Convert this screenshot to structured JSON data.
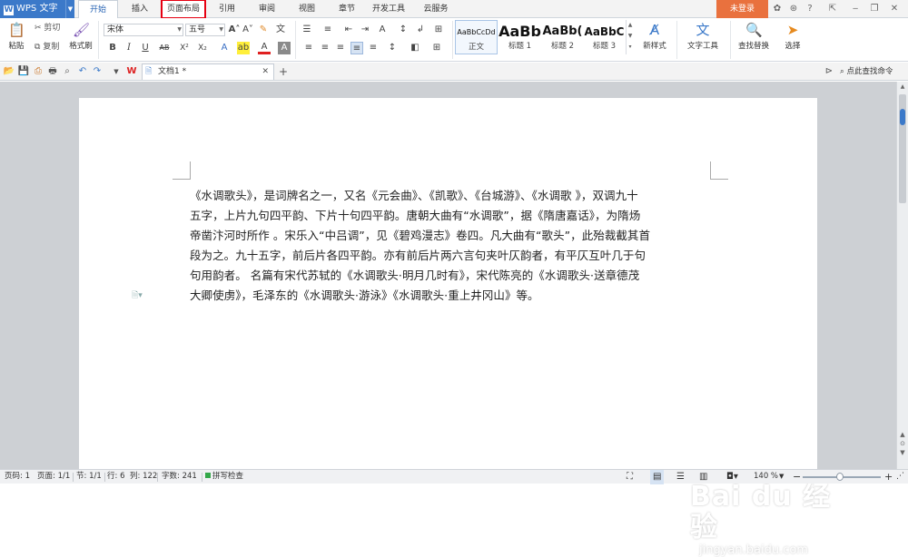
{
  "app": {
    "name": "WPS 文字",
    "login_label": "未登录"
  },
  "tabs": [
    "开始",
    "插入",
    "页面布局",
    "引用",
    "审阅",
    "视图",
    "章节",
    "开发工具",
    "云服务"
  ],
  "ribbon": {
    "clipboard": {
      "paste": "粘贴",
      "cut": "剪切",
      "copy": "复制",
      "format_painter": "格式刷"
    },
    "font": {
      "name": "宋体",
      "size": "五号"
    },
    "styles": [
      {
        "preview": "AaBbCcDd",
        "label": "正文"
      },
      {
        "preview": "AaBb",
        "label": "标题 1"
      },
      {
        "preview": "AaBb(",
        "label": "标题 2"
      },
      {
        "preview": "AaBbC",
        "label": "标题 3"
      }
    ],
    "new_style": "新样式",
    "text_tools": "文字工具",
    "find_replace": "查找替换",
    "select": "选择"
  },
  "quickbar": {
    "doc_tab": "文档1 *",
    "search_cmd": "点此查找命令"
  },
  "document": {
    "lines": [
      "《水调歌头》，是词牌名之一，又名《元会曲》、《凯歌》、《台城游》、《水调歌 》，双调九十",
      "五字，上片九句四平韵、下片十句四平韵。唐朝大曲有“水调歌”，据《隋唐嘉话》，为隋炀",
      "帝凿汴河时所作 。宋乐入“中吕调”，见《碧鸡漫志》卷四。凡大曲有“歌头”，此殆裁截其首",
      "段为之。九十五字，前后片各四平韵。亦有前后片两六言句夹叶仄韵者，有平仄互叶几于句",
      "句用韵者。  名篇有宋代苏轼的《水调歌头·明月几时有》，宋代陈亮的《水调歌头·送章德茂",
      "大卿使虏》，毛泽东的《水调歌头·游泳》《水调歌头·重上井冈山》等。"
    ]
  },
  "status": {
    "page_no": "页码: 1",
    "pages": "页面: 1/1",
    "section": "节: 1/1",
    "row": "行: 6",
    "col": "列: 122",
    "words": "字数: 241",
    "spell": "拼写检查",
    "zoom": "140 %"
  },
  "watermark": {
    "brand": "Bai du 经验",
    "url": "jingyan.baidu.com"
  },
  "colors": {
    "accent": "#3b79c9",
    "login": "#e9713e",
    "highlight_box": "#e60012"
  }
}
